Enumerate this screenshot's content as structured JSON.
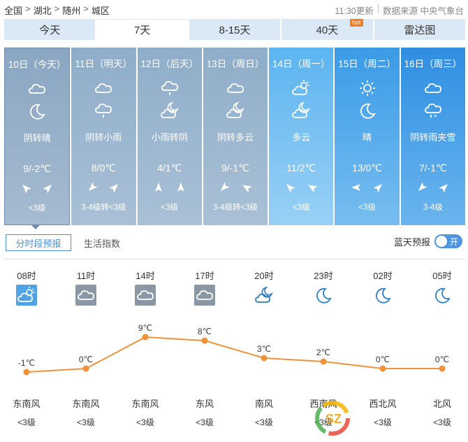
{
  "breadcrumb": {
    "items": [
      "全国",
      "湖北",
      "随州",
      "城区"
    ],
    "separator": ">",
    "update_time": "11:30更新",
    "source": "数据来源 中央气象台",
    "divider": "|"
  },
  "tabs": [
    {
      "label": "今天",
      "active": false
    },
    {
      "label": "7天",
      "active": true
    },
    {
      "label": "8-15天",
      "active": false
    },
    {
      "label": "40天",
      "active": false,
      "badge": "hot"
    },
    {
      "label": "雷达图",
      "active": false
    }
  ],
  "days": [
    {
      "date": "10日（今天）",
      "icon1": "cloud-icon",
      "icon2": "moon-icon",
      "desc": "阴转晴",
      "temp": "9/-2℃",
      "wind_level": "<3级",
      "style": "today"
    },
    {
      "date": "11日（明天）",
      "icon1": "cloud-icon",
      "icon2": "light-rain-icon",
      "desc": "阴转小雨",
      "temp": "8/0℃",
      "wind_level": "3-4级转<3级",
      "style": "gray"
    },
    {
      "date": "12日（后天）",
      "icon1": "light-rain-icon",
      "icon2": "partly-cloudy-night-icon",
      "desc": "小雨转阴",
      "temp": "4/1℃",
      "wind_level": "<3级",
      "style": "gray"
    },
    {
      "date": "13日（周日）",
      "icon1": "cloud-icon",
      "icon2": "partly-cloudy-night-icon",
      "desc": "阴转多云",
      "temp": "9/-1℃",
      "wind_level": "3-4级转<3级",
      "style": "gray"
    },
    {
      "date": "14日（周一）",
      "icon1": "partly-cloudy-icon",
      "icon2": "partly-cloudy-night-icon",
      "desc": "多云",
      "temp": "11/2℃",
      "wind_level": "<3级",
      "style": "blue-l"
    },
    {
      "date": "15日（周二）",
      "icon1": "sun-icon",
      "icon2": "moon-icon",
      "desc": "晴",
      "temp": "13/0℃",
      "wind_level": "<3级",
      "style": "blue"
    },
    {
      "date": "16日（周三）",
      "icon1": "cloud-icon",
      "icon2": "sleet-icon",
      "desc": "阴转雨夹雪",
      "temp": "7/-1℃",
      "wind_level": "3-4级",
      "style": "blue-d"
    }
  ],
  "subtabs": {
    "hourly": "分时段预报",
    "life_index": "生活指数",
    "bluesky_label": "蓝天预报",
    "toggle_label": "开"
  },
  "hourly": [
    {
      "time": "08时",
      "icon": "partly-cloudy-icon",
      "wind_dir": "东南风",
      "wind_level": "<3级"
    },
    {
      "time": "11时",
      "icon": "cloud-icon",
      "wind_dir": "东南风",
      "wind_level": "<3级"
    },
    {
      "time": "14时",
      "icon": "cloud-icon",
      "wind_dir": "东南风",
      "wind_level": "<3级"
    },
    {
      "time": "17时",
      "icon": "cloud-icon",
      "wind_dir": "东风",
      "wind_level": "<3级"
    },
    {
      "time": "20时",
      "icon": "partly-cloudy-night-icon",
      "wind_dir": "南风",
      "wind_level": "<3级"
    },
    {
      "time": "23时",
      "icon": "moon-icon",
      "wind_dir": "西南风",
      "wind_level": "<3级"
    },
    {
      "time": "02时",
      "icon": "moon-icon",
      "wind_dir": "西北风",
      "wind_level": "<3级"
    },
    {
      "time": "05时",
      "icon": "moon-icon",
      "wind_dir": "北风",
      "wind_level": "<3级"
    }
  ],
  "chart_data": {
    "type": "line",
    "x": [
      "08时",
      "11时",
      "14时",
      "17时",
      "20时",
      "23时",
      "02时",
      "05时"
    ],
    "series": [
      {
        "values": [
          -1,
          0,
          9,
          8,
          3,
          2,
          0,
          0
        ]
      }
    ],
    "labels": [
      "-1℃",
      "0℃",
      "9℃",
      "8℃",
      "3℃",
      "2℃",
      "0℃",
      "0℃"
    ],
    "ylim": [
      -1,
      9
    ],
    "color": "#f0923a"
  },
  "colors": {
    "accent": "#4a90d9",
    "tab_bg": "#dbe9f6",
    "line": "#f0923a"
  }
}
